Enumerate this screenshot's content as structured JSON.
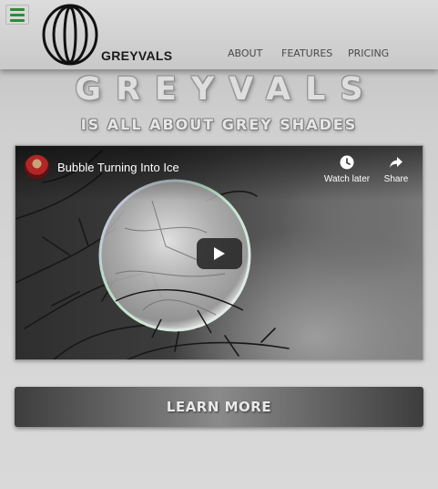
{
  "header": {
    "brand": "GREYVALS",
    "nav": [
      "ABOUT",
      "FEATURES",
      "PRICING"
    ]
  },
  "hero": {
    "title": "GREYVALS",
    "subtitle": "IS ALL ABOUT GREY SHADES"
  },
  "video": {
    "title": "Bubble Turning Into Ice",
    "watch_later_label": "Watch later",
    "share_label": "Share"
  },
  "cta": {
    "label": "LEARN MORE"
  },
  "colors": {
    "menu_icon": "#2e8b3a",
    "header_bg": "#d0d0d0",
    "page_bg": "#d2d2d2",
    "cta_dark": "#3d3d3d",
    "cta_light": "#8a8a8a"
  }
}
